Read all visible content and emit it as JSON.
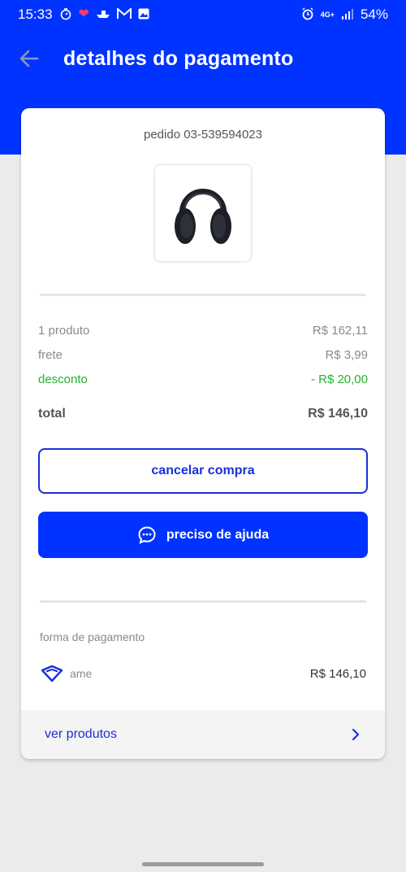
{
  "status_bar": {
    "time": "15:33",
    "battery": "54%",
    "network": "4G+"
  },
  "header": {
    "title": "detalhes do pagamento",
    "back_icon": "arrow-left-icon"
  },
  "order": {
    "id_text": "pedido 03-539594023",
    "product_image": "headphones"
  },
  "summary": {
    "products_label": "1 produto",
    "products_value": "R$ 162,11",
    "shipping_label": "frete",
    "shipping_value": "R$ 3,99",
    "discount_label": "desconto",
    "discount_value": "- R$ 20,00",
    "total_label": "total",
    "total_value": "R$ 146,10"
  },
  "actions": {
    "cancel_label": "cancelar compra",
    "help_label": "preciso de ajuda"
  },
  "payment": {
    "section_label": "forma de pagamento",
    "method_name": "ame",
    "method_amount": "R$ 146,10"
  },
  "footer": {
    "view_products_label": "ver produtos"
  },
  "colors": {
    "brand_blue": "#0033ff",
    "discount_green": "#22b22c",
    "background": "#ebebeb"
  }
}
